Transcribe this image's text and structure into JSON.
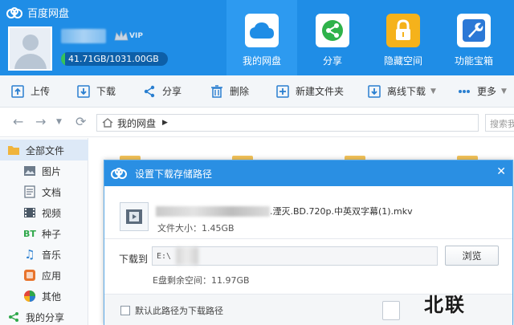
{
  "app": {
    "title": "百度网盘",
    "vip_badge": "VIP",
    "quota_text": "41.71GB/1031.00GB",
    "quota_used_fraction": 0.04
  },
  "nav": [
    {
      "label": "我的网盘",
      "icon": "cloud-icon",
      "color": "#1f8de6",
      "active": true
    },
    {
      "label": "分享",
      "icon": "share-icon",
      "color": "#2fb24a",
      "active": false
    },
    {
      "label": "隐藏空间",
      "icon": "lock-icon",
      "color": "#f5b21b",
      "active": false
    },
    {
      "label": "功能宝箱",
      "icon": "wrench-icon",
      "color": "#2b78d6",
      "active": false
    }
  ],
  "toolbar": {
    "upload": "上传",
    "download": "下载",
    "share": "分享",
    "delete": "删除",
    "new_folder": "新建文件夹",
    "offline_download": "离线下载",
    "more": "更多"
  },
  "address": {
    "path_root": "我的网盘",
    "search_placeholder": "搜索我"
  },
  "sidebar": {
    "items": [
      {
        "label": "全部文件",
        "icon": "folder-icon",
        "active": true
      },
      {
        "label": "图片",
        "icon": "image-icon"
      },
      {
        "label": "文档",
        "icon": "document-icon"
      },
      {
        "label": "视频",
        "icon": "video-icon"
      },
      {
        "label": "种子",
        "icon": "bt-icon"
      },
      {
        "label": "音乐",
        "icon": "music-icon"
      },
      {
        "label": "应用",
        "icon": "apps-icon"
      },
      {
        "label": "其他",
        "icon": "other-icon"
      },
      {
        "label": "我的分享",
        "icon": "share-icon"
      }
    ]
  },
  "dialog": {
    "title": "设置下载存储路径",
    "file_name_suffix": ".湮灭.BD.720p.中英双字幕(1).mkv",
    "file_size": "文件大小：1.45GB",
    "download_to_label": "下载到",
    "download_path": "E:\\",
    "browse_button": "浏览",
    "free_space": "E盘剩余空间：11.97GB",
    "default_path_checkbox": "默认此路径为下载路径",
    "close": "✕"
  },
  "watermark": {
    "text": "北联"
  },
  "colors": {
    "header_blue": "#1f8de6",
    "dialog_title_blue": "#2a8fe3",
    "quota_green": "#35c25a"
  }
}
